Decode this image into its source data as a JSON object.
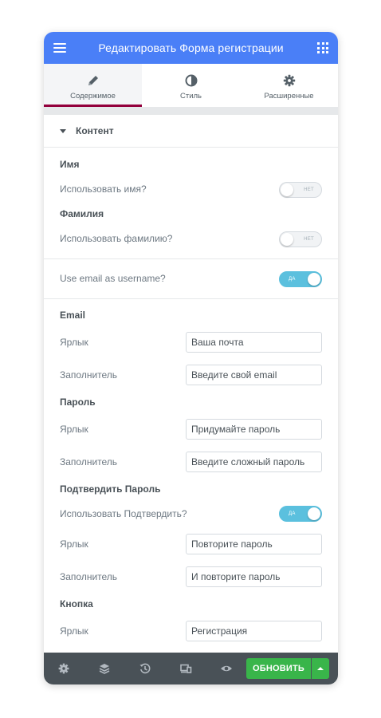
{
  "header": {
    "title": "Редактировать Форма регистрации",
    "menu_icon": "hamburger-menu-icon",
    "apps_icon": "grid-apps-icon"
  },
  "tabs": [
    {
      "label": "Содержимое",
      "icon": "pencil-icon",
      "active": true
    },
    {
      "label": "Стиль",
      "icon": "half-circle-icon",
      "active": false
    },
    {
      "label": "Расширенные",
      "icon": "gear-icon",
      "active": false
    }
  ],
  "section": {
    "title": "Контент"
  },
  "name_group": {
    "heading": "Имя",
    "toggle_label": "Использовать имя?",
    "toggle_text": "НЕТ"
  },
  "surname_group": {
    "heading": "Фамилия",
    "toggle_label": "Использовать фамилию?",
    "toggle_text": "НЕТ"
  },
  "email_username": {
    "label": "Use email as username?",
    "toggle_text": "ДА"
  },
  "email_group": {
    "heading": "Email",
    "label_caption": "Ярлык",
    "label_value": "Ваша почта",
    "placeholder_caption": "Заполнитель",
    "placeholder_value": "Введите свой email"
  },
  "password_group": {
    "heading": "Пароль",
    "label_caption": "Ярлык",
    "label_value": "Придумайте пароль",
    "placeholder_caption": "Заполнитель",
    "placeholder_value": "Введите сложный пароль"
  },
  "confirm_group": {
    "heading": "Подтвердить Пароль",
    "toggle_label": "Использовать Подтвердить?",
    "toggle_text": "ДА",
    "label_caption": "Ярлык",
    "label_value": "Повторите пароль",
    "placeholder_caption": "Заполнитель",
    "placeholder_value": "И повторите пароль"
  },
  "button_group": {
    "heading": "Кнопка",
    "label_caption": "Ярлык",
    "label_value": "Регистрация"
  },
  "footer": {
    "update_label": "ОБНОВИТЬ",
    "icons": [
      "settings-icon",
      "layers-icon",
      "history-icon",
      "responsive-icon",
      "eye-icon"
    ]
  },
  "colors": {
    "header": "#4a7ff7",
    "tab_active_underline": "#93003c",
    "switch_on": "#5bc0de",
    "footer": "#495157",
    "update_button": "#39b54a"
  }
}
